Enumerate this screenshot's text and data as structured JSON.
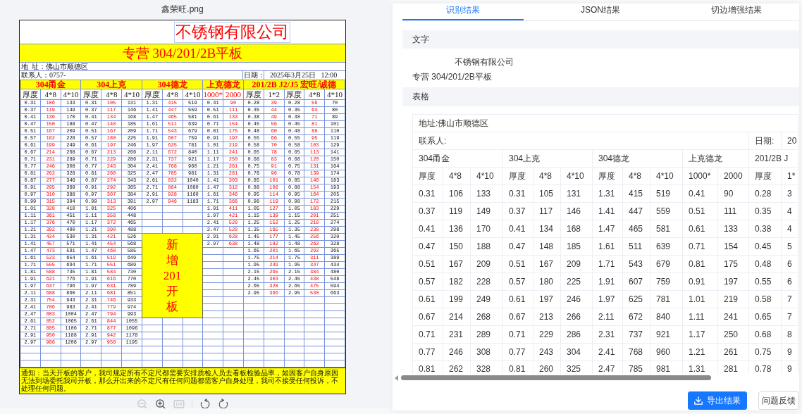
{
  "viewer": {
    "file_name": "鑫荣旺.png"
  },
  "document": {
    "title": "不锈钢有限公司",
    "banner": "专营 304/201/2B平板",
    "address": "地  址：佛山市顺德区",
    "contact": "联系人：0757-",
    "date_label": "日期：",
    "date_value": "2025年3月25日   12:00",
    "groups": [
      {
        "name": "304甬金",
        "sections": [
          {
            "kind": "standard",
            "columns": [
              "厚度",
              "4*8",
              "4*10"
            ],
            "rows": [
              [
                "0.31",
                "106",
                "133"
              ],
              [
                "0.37",
                "119",
                "149"
              ],
              [
                "0.41",
                "136",
                "170"
              ],
              [
                "0.47",
                "150",
                "188"
              ],
              [
                "0.51",
                "167",
                "209"
              ],
              [
                "0.57",
                "182",
                "228"
              ],
              [
                "0.61",
                "199",
                "249"
              ],
              [
                "0.67",
                "214",
                "268"
              ],
              [
                "0.71",
                "231",
                "289"
              ],
              [
                "0.77",
                "246",
                "308"
              ],
              [
                "0.81",
                "262",
                "328"
              ],
              [
                "0.87",
                "277",
                "346"
              ],
              [
                "0.91",
                "295",
                "369"
              ],
              [
                "0.97",
                "310",
                "388"
              ],
              [
                "0.99",
                "315",
                "394"
              ],
              [
                "1.01",
                "328",
                "410"
              ],
              [
                "1.11",
                "361",
                "451"
              ],
              [
                "1.17",
                "376",
                "470"
              ],
              [
                "1.21",
                "392",
                "490"
              ],
              [
                "1.31",
                "424",
                "530"
              ],
              [
                "1.41",
                "457",
                "571"
              ],
              [
                "1.47",
                "473",
                "591"
              ],
              [
                "1.61",
                "523",
                "654"
              ],
              [
                "1.71",
                "555",
                "694"
              ],
              [
                "1.81",
                "588",
                "735"
              ],
              [
                "1.91",
                "621",
                "776"
              ],
              [
                "1.97",
                "637",
                "796"
              ],
              [
                "2.11",
                "688",
                "860"
              ],
              [
                "2.31",
                "754",
                "943"
              ],
              [
                "2.41",
                "786",
                "983"
              ],
              [
                "2.47",
                "803",
                "1004"
              ],
              [
                "2.61",
                "852",
                "1065"
              ],
              [
                "2.71",
                "885",
                "1106"
              ],
              [
                "2.91",
                "950",
                "1188"
              ],
              [
                "2.97",
                "966",
                "1208"
              ]
            ]
          }
        ]
      },
      {
        "name": "304上克",
        "sections": [
          {
            "kind": "standard",
            "columns": [
              "厚度",
              "4*8",
              "4*10"
            ],
            "rows": [
              [
                "0.31",
                "105",
                "131"
              ],
              [
                "0.37",
                "117",
                "146"
              ],
              [
                "0.41",
                "134",
                "168"
              ],
              [
                "0.47",
                "148",
                "185"
              ],
              [
                "0.51",
                "167",
                "209"
              ],
              [
                "0.57",
                "180",
                "225"
              ],
              [
                "0.61",
                "197",
                "246"
              ],
              [
                "0.67",
                "213",
                "266"
              ],
              [
                "0.71",
                "229",
                "286"
              ],
              [
                "0.77",
                "243",
                "304"
              ],
              [
                "0.81",
                "260",
                "325"
              ],
              [
                "0.87",
                "274",
                "343"
              ],
              [
                "0.91",
                "292",
                "365"
              ],
              [
                "0.97",
                "307",
                "384"
              ],
              [
                "0.99",
                "313",
                "391"
              ],
              [
                "1.01",
                "325",
                "406"
              ],
              [
                "1.11",
                "358",
                "448"
              ],
              [
                "1.17",
                "372",
                "465"
              ],
              [
                "1.21",
                "390",
                "488"
              ],
              [
                "1.31",
                "421",
                "526"
              ],
              [
                "1.41",
                "454",
                "568"
              ],
              [
                "1.47",
                "468",
                "585"
              ],
              [
                "1.61",
                "519",
                "649"
              ],
              [
                "1.71",
                "551",
                "689"
              ],
              [
                "1.81",
                "584",
                "730"
              ],
              [
                "1.91",
                "616",
                "770"
              ],
              [
                "1.97",
                "631",
                "789"
              ],
              [
                "2.11",
                "681",
                "851"
              ],
              [
                "2.31",
                "746",
                "933"
              ],
              [
                "2.41",
                "779",
                "974"
              ],
              [
                "2.47",
                "794",
                "993"
              ],
              [
                "2.61",
                "844",
                "1055"
              ],
              [
                "2.71",
                "877",
                "1096"
              ],
              [
                "2.91",
                "942",
                "1178"
              ],
              [
                "2.97",
                "956",
                "1195"
              ]
            ]
          }
        ]
      },
      {
        "name": "304德龙",
        "sections": [
          {
            "kind": "standard",
            "columns": [
              "厚度",
              "4*8",
              "4*10"
            ],
            "rows": [
              [
                "1.31",
                "415",
                "519"
              ],
              [
                "1.41",
                "447",
                "559"
              ],
              [
                "1.47",
                "465",
                "581"
              ],
              [
                "1.61",
                "511",
                "639"
              ],
              [
                "1.71",
                "543",
                "679"
              ],
              [
                "1.91",
                "607",
                "759"
              ],
              [
                "1.97",
                "625",
                "781"
              ],
              [
                "2.11",
                "672",
                "840"
              ],
              [
                "2.31",
                "737",
                "921"
              ],
              [
                "2.41",
                "768",
                "960"
              ],
              [
                "2.47",
                "785",
                "981"
              ],
              [
                "2.61",
                "832",
                "1040"
              ],
              [
                "2.71",
                "864",
                "1080"
              ],
              [
                "2.91",
                "928",
                "1160"
              ],
              [
                "2.97",
                "946",
                "1183"
              ]
            ],
            "note": "新增201开板"
          }
        ]
      },
      {
        "name": "上克德龙",
        "sections": [
          {
            "kind": "highlighted",
            "columns": [
              "1000*",
              "2000"
            ],
            "rows": [
              [
                "0.41",
                "90"
              ],
              [
                "0.51",
                "111"
              ],
              [
                "0.61",
                "133"
              ],
              [
                "0.71",
                "154"
              ],
              [
                "0.81",
                "175"
              ],
              [
                "0.91",
                "197"
              ],
              [
                "1.01",
                "219"
              ],
              [
                "1.11",
                "241"
              ],
              [
                "1.17",
                "250"
              ],
              [
                "1.21",
                "261"
              ],
              [
                "1.31",
                "281"
              ],
              [
                "1.41",
                "303"
              ],
              [
                "1.47",
                "312"
              ],
              [
                "1.61",
                "346"
              ],
              [
                "1.71",
                "368"
              ],
              [
                "1.91",
                "411"
              ],
              [
                "1.97",
                "421"
              ],
              [
                "2.41",
                "520"
              ],
              [
                "2.47",
                "529"
              ],
              [
                "2.91",
                "628"
              ],
              [
                "2.97",
                "638"
              ]
            ]
          }
        ]
      },
      {
        "name": "201/2B J2/J5 宏旺/诚德",
        "sections": [
          {
            "kind": "standard",
            "columns": [
              "厚度",
              "1*2"
            ],
            "rows": [
              [
                "0.28",
                "39"
              ],
              [
                "0.35",
                "44"
              ],
              [
                "0.38",
                "49"
              ],
              [
                "0.45",
                "56"
              ],
              [
                "0.48",
                "60"
              ],
              [
                "0.55",
                "66"
              ],
              [
                "0.58",
                "70"
              ],
              [
                "0.65",
                "78"
              ],
              [
                "0.68",
                "83"
              ],
              [
                "0.75",
                "91"
              ],
              [
                "0.78",
                "96"
              ],
              [
                "0.85",
                "101"
              ],
              [
                "0.88",
                "106"
              ],
              [
                "0.95",
                "114"
              ],
              [
                "0.98",
                "119"
              ],
              [
                "1.05",
                "127"
              ],
              [
                "1.15",
                "139"
              ],
              [
                "1.25",
                "152"
              ],
              [
                "1.35",
                "165"
              ],
              [
                "1.45",
                "177"
              ],
              [
                "1.48",
                "182"
              ],
              [
                "1.65",
                "201"
              ],
              [
                "1.75",
                "214"
              ],
              [
                "1.95",
                "239"
              ],
              [
                "2.15",
                "265"
              ],
              [
                "2.45",
                "303"
              ],
              [
                "2.65",
                "328"
              ],
              [
                "2.95",
                "366"
              ]
            ]
          },
          {
            "kind": "standard",
            "columns": [
              "厚度",
              "4*8",
              "4*10"
            ],
            "rows": [
              [
                "0.28",
                "56",
                "70"
              ],
              [
                "0.35",
                "64",
                "80"
              ],
              [
                "0.38",
                "71",
                "89"
              ],
              [
                "0.45",
                "81",
                "101"
              ],
              [
                "0.48",
                "88",
                "110"
              ],
              [
                "0.55",
                "95",
                "119"
              ],
              [
                "0.58",
                "103",
                "129"
              ],
              [
                "0.65",
                "113",
                "141"
              ],
              [
                "0.68",
                "120",
                "150"
              ],
              [
                "0.75",
                "131",
                "164"
              ],
              [
                "0.78",
                "139",
                "174"
              ],
              [
                "0.85",
                "146",
                "183"
              ],
              [
                "0.88",
                "154",
                "193"
              ],
              [
                "0.95",
                "164",
                "205"
              ],
              [
                "0.98",
                "172",
                "215"
              ],
              [
                "1.05",
                "183",
                "229"
              ],
              [
                "1.15",
                "201",
                "251"
              ],
              [
                "1.25",
                "219",
                "274"
              ],
              [
                "1.35",
                "238",
                "298"
              ],
              [
                "1.45",
                "256",
                "320"
              ],
              [
                "1.48",
                "262",
                "328"
              ],
              [
                "1.65",
                "292",
                "365"
              ],
              [
                "1.75",
                "311",
                "389"
              ],
              [
                "1.95",
                "347",
                "434"
              ],
              [
                "2.15",
                "384",
                "480"
              ],
              [
                "2.45",
                "438",
                "548"
              ],
              [
                "2.65",
                "475",
                "594"
              ],
              [
                "2.95",
                "530",
                "663"
              ]
            ]
          }
        ]
      }
    ],
    "notice": "通知：当天开板的客户，我司规定所有不定尺都需要安排质检人员去看板检验品率，如因客户自身原因无法到场委托我司开板，那么开出来的不定尺有任何问题都需客户自身处理，我司不接受任何投诉，不处理任何问题。"
  },
  "toolbar": {
    "zoom_controls": [
      {
        "kind": "zoom-out",
        "disabled": true
      },
      {
        "kind": "zoom-in",
        "disabled": false
      },
      {
        "kind": "actual-size",
        "disabled": true
      }
    ],
    "rotate_controls": [
      {
        "kind": "rotate-left",
        "disabled": false
      },
      {
        "kind": "rotate-right",
        "disabled": false
      }
    ]
  },
  "results": {
    "tabs": [
      {
        "label": "识别结果",
        "selected": true
      },
      {
        "label": "JSON结果",
        "selected": false
      },
      {
        "label": "切边增强结果",
        "selected": false
      }
    ],
    "text_section": {
      "title": "文字",
      "lines": [
        {
          "kind": "indented",
          "text": "不锈钢有限公司"
        },
        {
          "kind": "plain",
          "text": "专营 304/201/2B平板"
        }
      ]
    },
    "table_section": {
      "title": "表格",
      "address": "地址:佛山市顺德区",
      "contact": "联系人:",
      "date_label": "日期:",
      "date_value": "20",
      "groups": [
        {
          "name": "304甬金",
          "columns": [
            "厚度",
            "4*8",
            "4*10"
          ]
        },
        {
          "name": "304上克",
          "columns": [
            "厚度",
            "4*8",
            "4*10"
          ]
        },
        {
          "name": "304德龙",
          "columns": [
            "厚度",
            "4*8",
            "4*10"
          ]
        },
        {
          "name": "上克德龙",
          "columns": [
            "1000*",
            "2000"
          ]
        },
        {
          "name": "201/2B J",
          "columns": [
            "厚度",
            "1*"
          ]
        }
      ],
      "rows": [
        [
          "0.31",
          "106",
          "133",
          "0.31",
          "105",
          "131",
          "1.31",
          "415",
          "519",
          "0.41",
          "90",
          "0.28",
          "3"
        ],
        [
          "0.37",
          "119",
          "149",
          "0.37",
          "117",
          "146",
          "1.41",
          "447",
          "559",
          "0.51",
          "111",
          "0.35",
          "4"
        ],
        [
          "0.41",
          "136",
          "170",
          "0.41",
          "134",
          "168",
          "1.47",
          "465",
          "581",
          "0.61",
          "133",
          "0.38",
          "4"
        ],
        [
          "0.47",
          "150",
          "188",
          "0.47",
          "148",
          "185",
          "1.61",
          "511",
          "639",
          "0.71",
          "154",
          "0.45",
          "5"
        ],
        [
          "0.51",
          "167",
          "209",
          "0.51",
          "167",
          "209",
          "1.71",
          "543",
          "679",
          "0.81",
          "175",
          "0.48",
          "6"
        ],
        [
          "0.57",
          "182",
          "228",
          "0.57",
          "180",
          "225",
          "1.91",
          "607",
          "759",
          "0.91",
          "197",
          "0.55",
          "6"
        ],
        [
          "0.61",
          "199",
          "249",
          "0.61",
          "197",
          "246",
          "1.97",
          "625",
          "781",
          "1.01",
          "219",
          "0.58",
          "7"
        ],
        [
          "0.67",
          "214",
          "268",
          "0.67",
          "213",
          "266",
          "2.11",
          "672",
          "840",
          "1.11",
          "241",
          "0.65",
          "7"
        ],
        [
          "0.71",
          "231",
          "289",
          "0.71",
          "229",
          "286",
          "2.31",
          "737",
          "921",
          "1.17",
          "250",
          "0.68",
          "8"
        ],
        [
          "0.77",
          "246",
          "308",
          "0.77",
          "243",
          "304",
          "2.41",
          "768",
          "960",
          "1.21",
          "261",
          "0.75",
          "9"
        ],
        [
          "0.81",
          "262",
          "328",
          "0.81",
          "260",
          "325",
          "2.47",
          "785",
          "981",
          "1.31",
          "281",
          "0.78",
          "9"
        ]
      ]
    },
    "buttons": [
      {
        "kind": "primary",
        "label": "导出结果"
      },
      {
        "kind": "default",
        "label": "问题反馈"
      }
    ]
  }
}
